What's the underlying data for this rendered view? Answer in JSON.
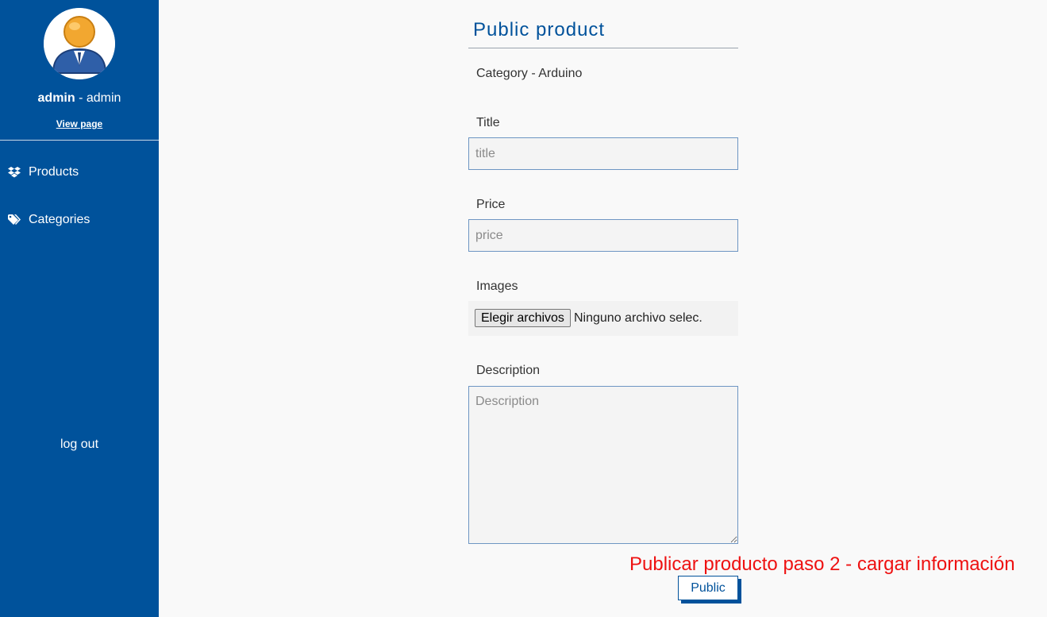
{
  "sidebar": {
    "username": "admin",
    "role_suffix": " - admin",
    "view_page": "View page",
    "nav": [
      {
        "label": "Products",
        "icon": "dropbox-icon"
      },
      {
        "label": "Categories",
        "icon": "tags-icon"
      }
    ],
    "logout": "log out"
  },
  "form": {
    "heading": "Public product",
    "category_line": "Category - Arduino",
    "title_label": "Title",
    "title_placeholder": "title",
    "price_label": "Price",
    "price_placeholder": "price",
    "images_label": "Images",
    "file_button": "Elegir archivos",
    "file_status": "Ninguno archivo selec.",
    "description_label": "Description",
    "description_placeholder": "Description",
    "submit": "Public"
  },
  "annotation": "Publicar producto paso 2 - cargar información",
  "colors": {
    "sidebar_bg": "#00529b",
    "accent": "#00529b",
    "annotation": "#ee1111"
  }
}
